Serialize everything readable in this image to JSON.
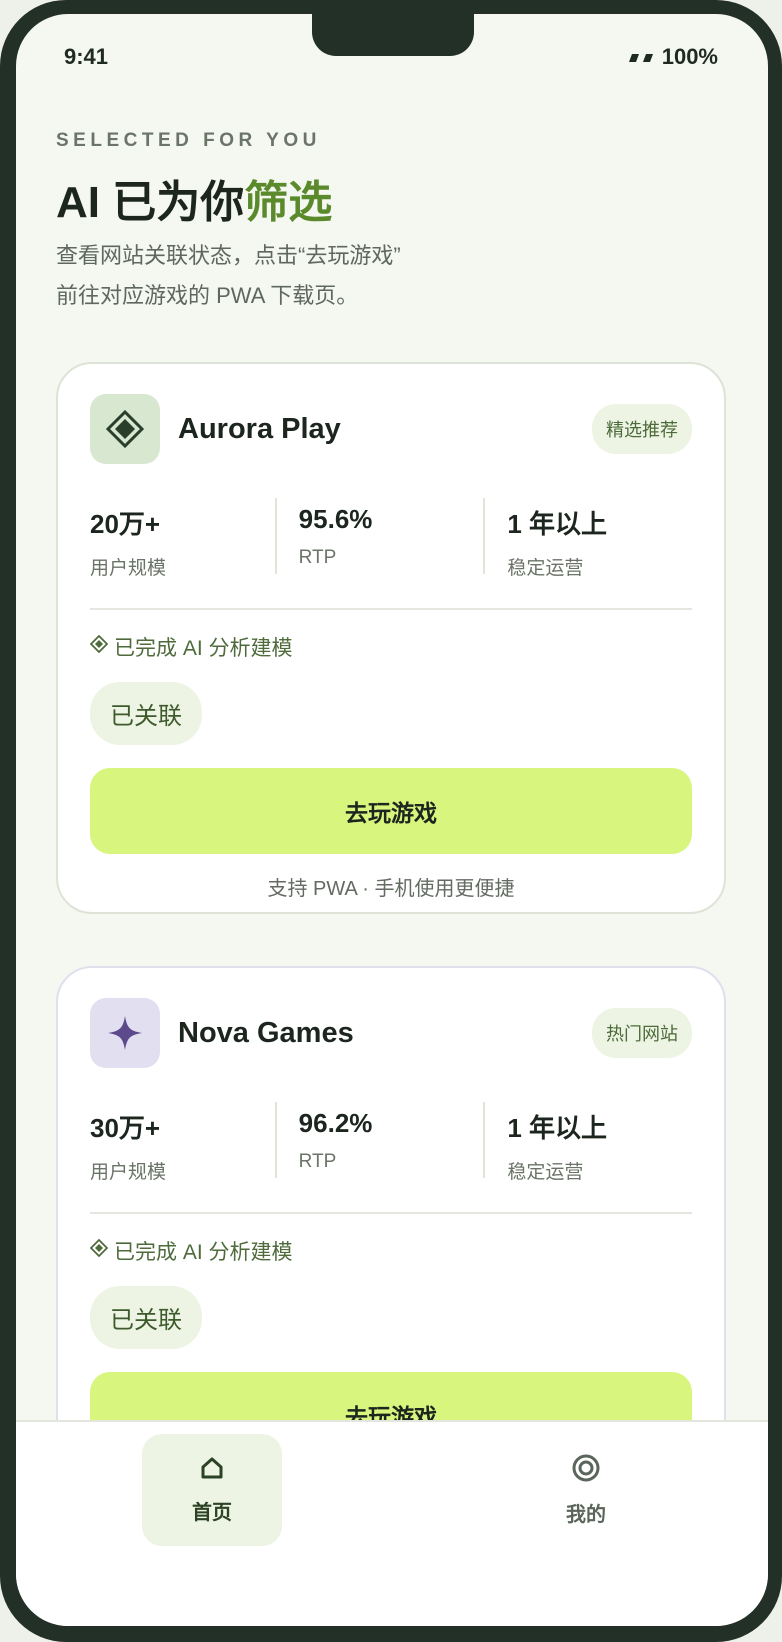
{
  "status_bar": {
    "time": "9:41",
    "battery": "100%"
  },
  "hero": {
    "eyebrow": "SELECTED FOR YOU",
    "title_main": "AI 已为你",
    "title_accent": "筛选",
    "subtitle_line1": "查看网站关联状态，点击“去玩游戏”",
    "subtitle_line2": "前往对应游戏的 PWA 下载页。"
  },
  "cards": [
    {
      "icon": "diamond-icon",
      "name": "Aurora Play",
      "tag": "精选推荐",
      "stats": [
        {
          "value": "20万+",
          "label": "用户规模"
        },
        {
          "value": "95.6%",
          "label": "RTP"
        },
        {
          "value": "1 年以上",
          "label": "稳定运营"
        }
      ],
      "ai_note": "已完成 AI 分析建模",
      "linked": "已关联",
      "play_label": "去玩游戏",
      "pwa_note": "支持 PWA · 手机使用更便捷"
    },
    {
      "icon": "sparkle-icon",
      "name": "Nova Games",
      "tag": "热门网站",
      "stats": [
        {
          "value": "30万+",
          "label": "用户规模"
        },
        {
          "value": "96.2%",
          "label": "RTP"
        },
        {
          "value": "1 年以上",
          "label": "稳定运营"
        }
      ],
      "ai_note": "已完成 AI 分析建模",
      "linked": "已关联",
      "play_label": "去玩游戏"
    }
  ],
  "tabbar": {
    "home": "首页",
    "mine": "我的"
  },
  "colors": {
    "accent": "#5b8a2c",
    "button": "#d8f57e",
    "frame": "#233027"
  }
}
